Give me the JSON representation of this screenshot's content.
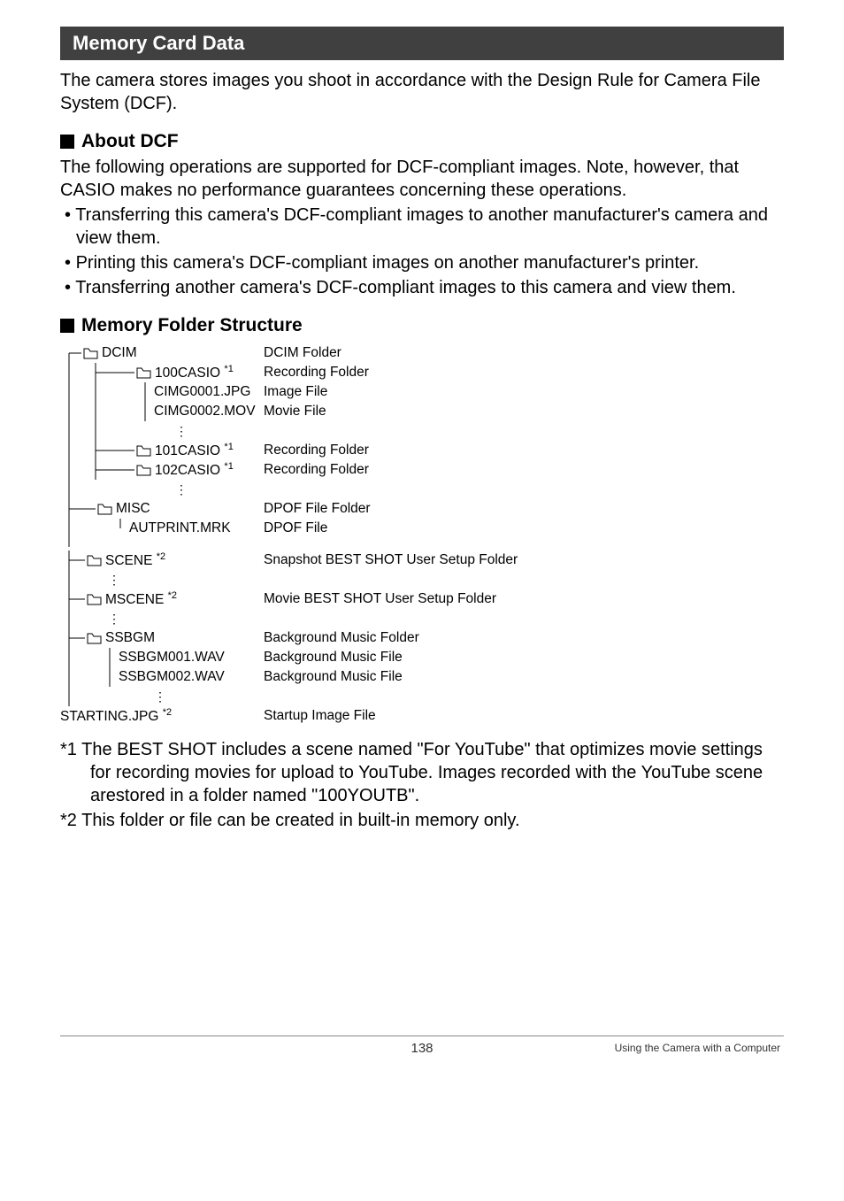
{
  "section_title": "Memory Card Data",
  "intro": "The camera stores images you shoot in accordance with the Design Rule for Camera File System (DCF).",
  "sub1_title": "About DCF",
  "sub1_text": "The following operations are supported for DCF-compliant images. Note, however, that CASIO makes no performance guarantees concerning these operations.",
  "sub1_bullets": [
    "Transferring this camera's DCF-compliant images to another manufacturer's camera and view them.",
    "Printing this camera's DCF-compliant images on another manufacturer's printer.",
    "Transferring another camera's DCF-compliant images to this camera and view them."
  ],
  "sub2_title": "Memory Folder Structure",
  "tree": {
    "dcim": {
      "label": "DCIM",
      "desc": "DCIM Folder"
    },
    "f100": {
      "label": "100CASIO",
      "sup": "*1",
      "desc": "Recording Folder"
    },
    "img1": {
      "label": "CIMG0001.JPG",
      "desc": "Image File"
    },
    "img2": {
      "label": "CIMG0002.MOV",
      "desc": "Movie File"
    },
    "f101": {
      "label": "101CASIO",
      "sup": "*1",
      "desc": "Recording Folder"
    },
    "f102": {
      "label": "102CASIO",
      "sup": "*1",
      "desc": "Recording Folder"
    },
    "misc": {
      "label": "MISC",
      "desc": "DPOF File Folder"
    },
    "aut": {
      "label": "AUTPRINT.MRK",
      "desc": "DPOF File"
    },
    "scene": {
      "label": "SCENE",
      "sup": "*2",
      "desc": "Snapshot BEST SHOT User Setup Folder"
    },
    "mscene": {
      "label": "MSCENE",
      "sup": "*2",
      "desc": "Movie BEST SHOT User Setup Folder"
    },
    "ssbgm": {
      "label": "SSBGM",
      "desc": "Background Music Folder"
    },
    "ss1": {
      "label": "SSBGM001.WAV",
      "desc": "Background Music File"
    },
    "ss2": {
      "label": "SSBGM002.WAV",
      "desc": "Background Music File"
    },
    "start": {
      "label": "STARTING.JPG",
      "sup": "*2",
      "desc": "Startup Image File"
    }
  },
  "note1": "*1 The BEST SHOT includes a scene named \"For YouTube\" that optimizes movie settings for recording movies for upload to YouTube. Images recorded with the YouTube scene arestored in a folder named \"100YOUTB\".",
  "note2": "*2 This folder or file can be created in built-in memory only.",
  "footer_page": "138",
  "footer_right": "Using the Camera with a Computer"
}
